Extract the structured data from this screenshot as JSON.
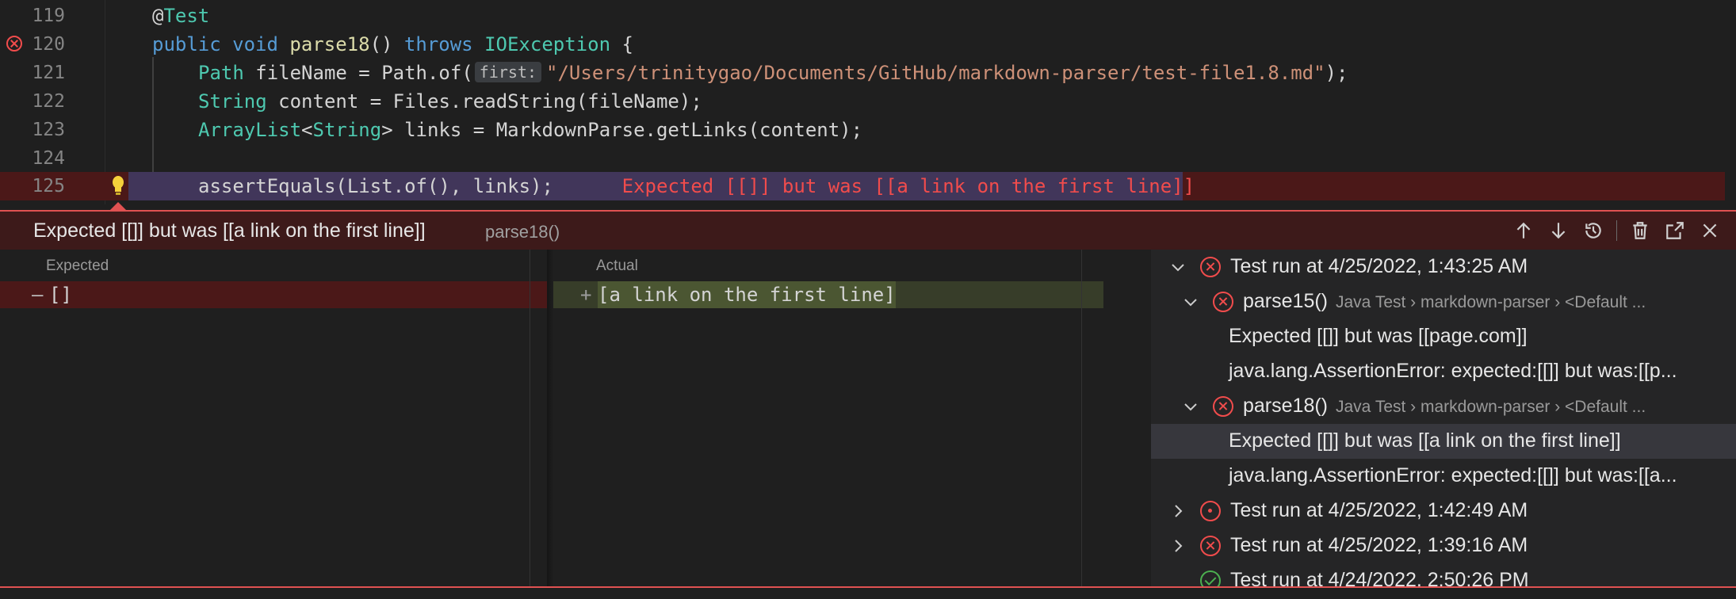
{
  "editor": {
    "lines": [
      {
        "num": "119",
        "annotation": "@",
        "annotation_name": "Test"
      },
      {
        "num": "120",
        "kw1": "public",
        "kw2": "void",
        "name": "parse18",
        "rest": "() ",
        "kw3": "throws",
        "type": "IOException",
        "tail": " {"
      },
      {
        "num": "121",
        "type": "Path",
        "mid": " fileName = Path.of(",
        "hint": "first:",
        "string": "\"/Users/trinitygao/Documents/GitHub/markdown-parser/test-file1.8.md\"",
        "tail": ");"
      },
      {
        "num": "122",
        "type": "String",
        "mid": " content = Files.readString(fileName);"
      },
      {
        "num": "123",
        "type": "ArrayList",
        "lt": "<",
        "type2": "String",
        "mid": "> links = MarkdownParse.getLinks(content);"
      },
      {
        "num": "124"
      },
      {
        "num": "125",
        "code": "assertEquals(List.of(), links);",
        "inline_error": "Expected [[]] but was [[a link on the first line]]"
      }
    ]
  },
  "peek": {
    "title": "Expected [[]] but was [[a link on the first line]]",
    "subtitle": "parse18()",
    "actions": [
      "arrow-up-icon",
      "arrow-down-icon",
      "history-icon",
      "trash-icon",
      "open-external-icon",
      "close-icon"
    ]
  },
  "diff": {
    "expected_label": "Expected",
    "actual_label": "Actual",
    "expected_marker": "—",
    "expected_value": "[]",
    "actual_marker": "+",
    "actual_value": "[a link on the first line]"
  },
  "tree": {
    "rows": [
      {
        "text": "Test run at 4/25/2022, 1:43:25 AM"
      },
      {
        "text": "parse15()",
        "desc": "Java Test › markdown-parser › <Default ..."
      },
      {
        "text": "Expected [[]] but was [[page.com]]"
      },
      {
        "text": "java.lang.AssertionError: expected:[[]] but was:[[p..."
      },
      {
        "text": "parse18()",
        "desc": "Java Test › markdown-parser › <Default ..."
      },
      {
        "text": "Expected [[]] but was [[a link on the first line]]"
      },
      {
        "text": "java.lang.AssertionError: expected:[[]] but was:[[a..."
      },
      {
        "text": "Test run at 4/25/2022, 1:42:49 AM"
      },
      {
        "text": "Test run at 4/25/2022, 1:39:16 AM"
      },
      {
        "text": "Test run at 4/24/2022, 2:50:26 PM"
      }
    ]
  },
  "colors": {
    "error": "#f14c4c",
    "pass": "#4caf50",
    "keyword": "#569cd6",
    "string": "#ce9178"
  }
}
